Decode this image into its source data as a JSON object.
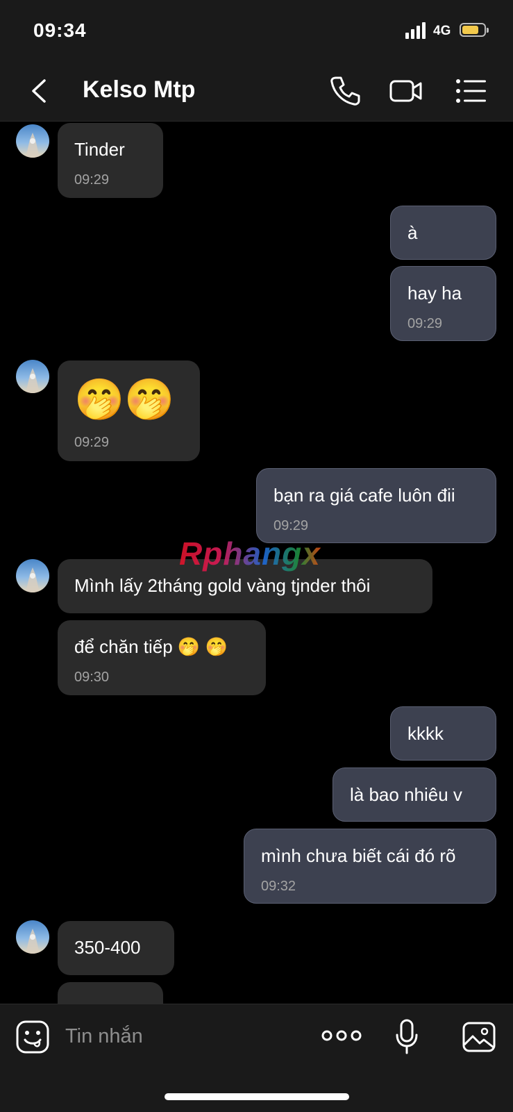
{
  "status_bar": {
    "time": "09:34",
    "network": "4G",
    "battery_level": 0.75,
    "battery_color": "#f2c94c"
  },
  "header": {
    "title": "Kelso Mtp",
    "back_icon": "chevron-left-icon",
    "call_icon": "phone-icon",
    "video_icon": "video-camera-icon",
    "menu_icon": "list-menu-icon"
  },
  "messages": [
    {
      "side": "in",
      "text": "Tinder",
      "time": "09:29"
    },
    {
      "side": "out",
      "text": "à"
    },
    {
      "side": "out",
      "text": "hay ha",
      "time": "09:29"
    },
    {
      "side": "in",
      "text": "🤭🤭",
      "time": "09:29"
    },
    {
      "side": "out",
      "text": "bạn ra giá cafe luôn đii",
      "time": "09:29"
    },
    {
      "side": "in",
      "text": "Mình lấy 2tháng gold vàng tjnder thôi"
    },
    {
      "side": "in",
      "text": "để chăn tiếp 🤭 🤭",
      "time": "09:30"
    },
    {
      "side": "out",
      "text": "kkkk"
    },
    {
      "side": "out",
      "text": "là bao nhiêu v"
    },
    {
      "side": "out",
      "text": "mình chưa biết cái đó rõ",
      "time": "09:32"
    },
    {
      "side": "in",
      "text": "350-400"
    }
  ],
  "watermark": "Rphangx",
  "composer": {
    "placeholder": "Tin nhắn",
    "sticker_icon": "sticker-face-icon",
    "more_icon": "more-dots-icon",
    "mic_icon": "microphone-icon",
    "gallery_icon": "image-gallery-icon"
  },
  "colors": {
    "incoming_bubble": "#2b2b2b",
    "outgoing_bubble": "#3d4150",
    "background": "#000000"
  }
}
